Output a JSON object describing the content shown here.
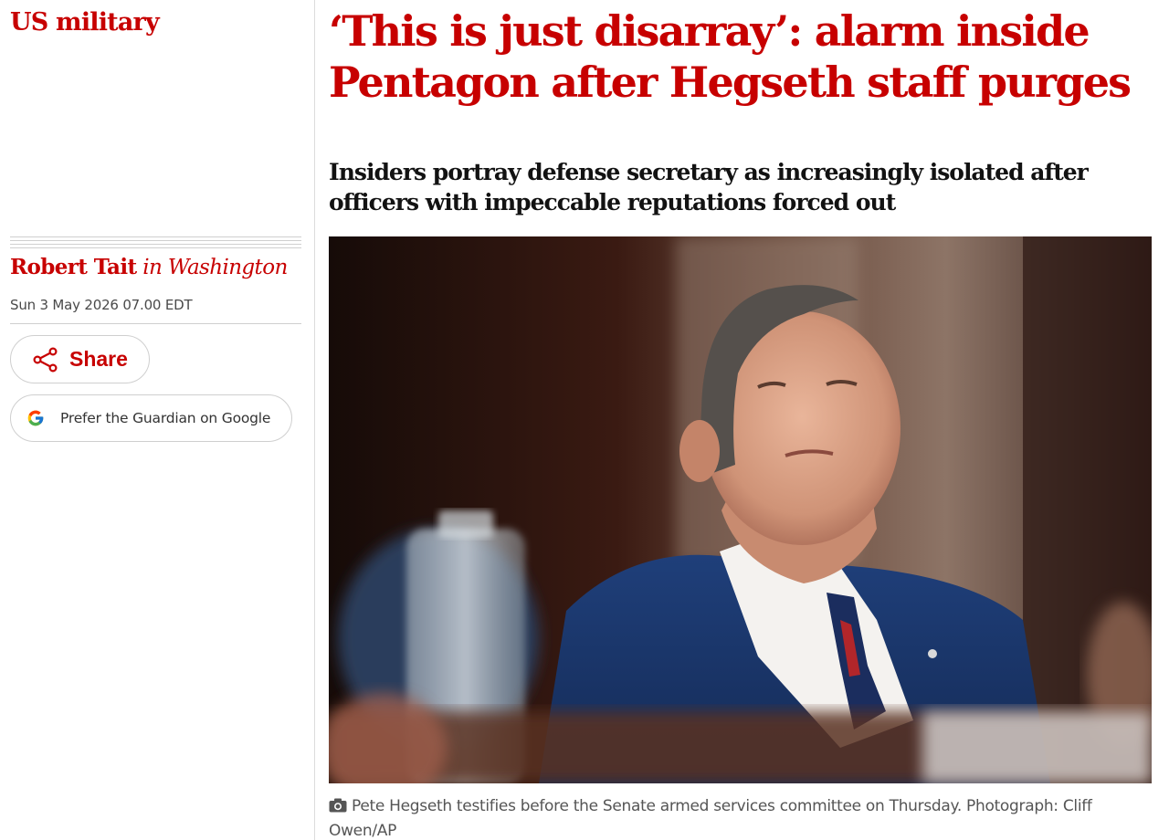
{
  "article": {
    "section": "US military",
    "headline": "‘This is just disarray’: alarm inside Pentagon after Hegseth staff purges",
    "standfirst": "Insiders portray defense secretary as increasingly isolated after officers with impeccable reputations forced out",
    "author": "Robert Tait",
    "location": "in Washington",
    "date": "Sun 3 May 2026 07.00 EDT",
    "caption": "Pete Hegseth testifies before the Senate armed services committee on Thursday. Photograph: Cliff Owen/AP"
  },
  "actions": {
    "share_label": "Share",
    "google_label": "Prefer the Guardian on Google"
  },
  "icons": {
    "share": "share-icon",
    "google": "google-g-icon",
    "camera": "camera-icon"
  },
  "colors": {
    "accent": "#c70000",
    "rule": "#cfcfcf",
    "text": "#121212",
    "meta": "#4a4a4a"
  }
}
